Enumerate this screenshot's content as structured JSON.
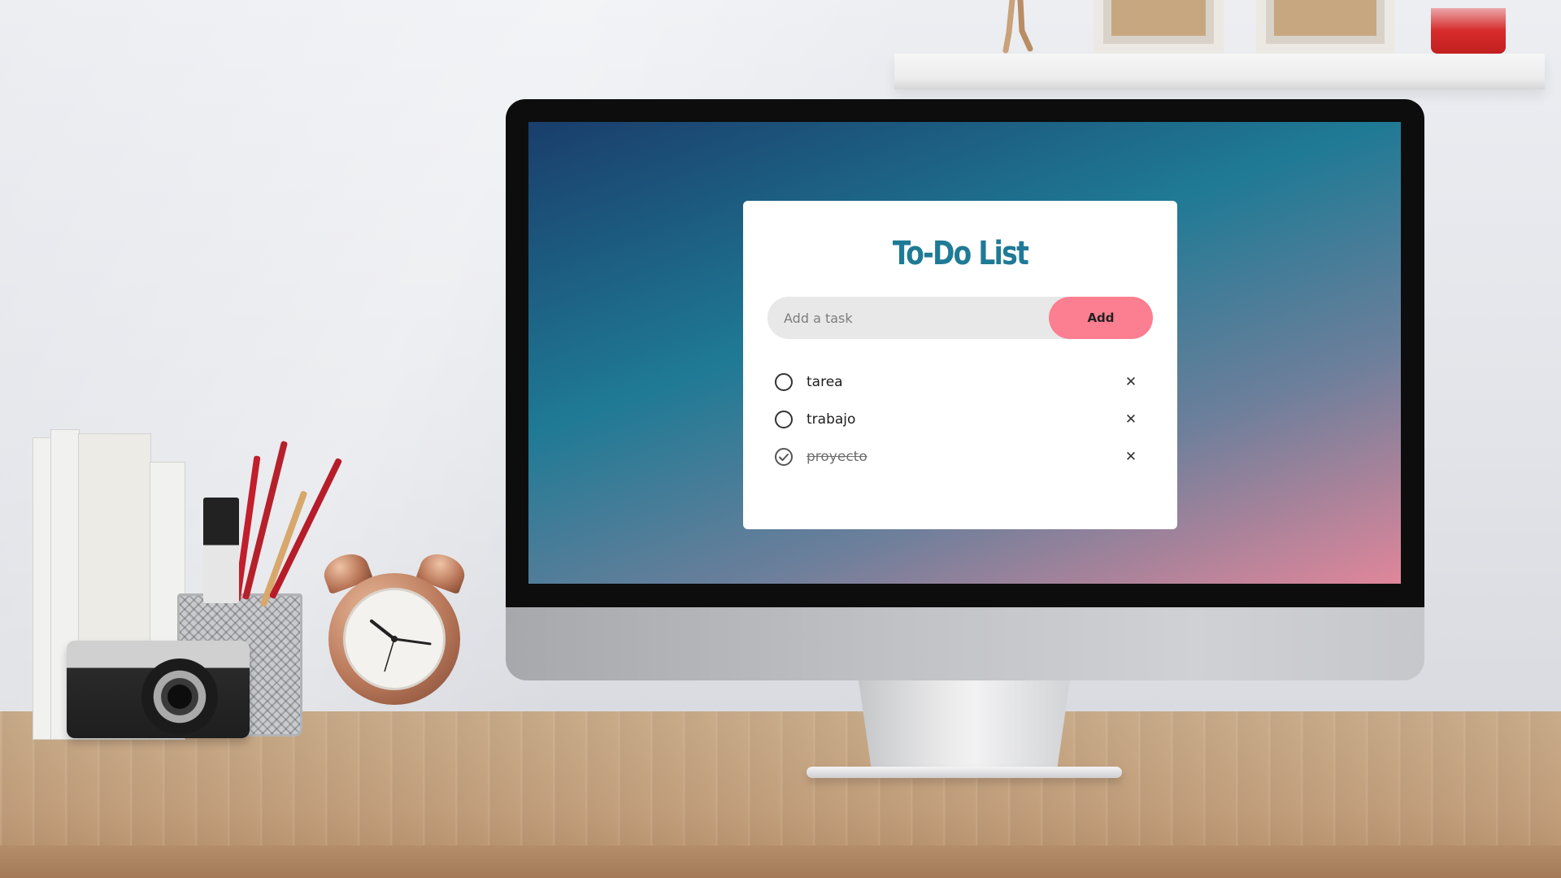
{
  "app": {
    "title": "To-Do List"
  },
  "input": {
    "placeholder": "Add a task",
    "value": ""
  },
  "add_button": {
    "label": "Add"
  },
  "tasks": [
    {
      "text": "tarea",
      "completed": false,
      "delete_icon": "close-icon"
    },
    {
      "text": "trabajo",
      "completed": false,
      "delete_icon": "close-icon"
    },
    {
      "text": "proyecto",
      "completed": true,
      "delete_icon": "close-icon"
    }
  ],
  "colors": {
    "title": "#1f7a95",
    "add_button": "#fb7f90",
    "input_bg": "#e8e8e8",
    "card_bg": "#ffffff",
    "screen_gradient": [
      "#1a3e6b",
      "#1f7a95",
      "#6d7f9b",
      "#e0869a"
    ]
  },
  "icons": {
    "unchecked": "circle-icon",
    "checked": "check-circle-icon",
    "delete": "close-icon"
  }
}
